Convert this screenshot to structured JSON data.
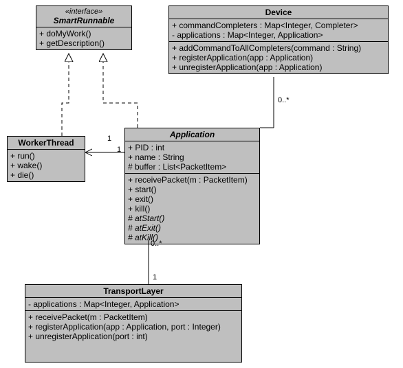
{
  "chart_data": {
    "type": "table",
    "diagram": "UML class diagram",
    "classes": [
      {
        "name": "SmartRunnable",
        "stereotype": "«interface»",
        "kind": "interface",
        "methods": [
          "+ doMyWork()",
          "+ getDescription()"
        ]
      },
      {
        "name": "Device",
        "kind": "class",
        "attributes": [
          "+ commandCompleters : Map<Integer, Completer>",
          "- applications : Map<Integer, Application>"
        ],
        "methods": [
          "+ addCommandToAllCompleters(command : String)",
          "+ registerApplication(app : Application)",
          "+ unregisterApplication(app : Application)"
        ]
      },
      {
        "name": "WorkerThread",
        "kind": "class",
        "methods": [
          "+ run()",
          "+ wake()",
          "+ die()"
        ]
      },
      {
        "name": "Application",
        "kind": "class",
        "attributes": [
          "+ PID : int",
          "+ name : String",
          "# buffer : List<PacketItem>"
        ],
        "methods": [
          "+ receivePacket(m : PacketItem)",
          "+ start()",
          "+ exit()",
          "+ kill()",
          "# atStart()",
          "# atExit()",
          "# atKill()"
        ],
        "abstract_methods": [
          "atStart()",
          "atExit()",
          "atKill()"
        ]
      },
      {
        "name": "TransportLayer",
        "kind": "class",
        "attributes": [
          "- applications : Map<Integer, Application>"
        ],
        "methods": [
          "+ receivePacket(m : PacketItem)",
          "+ registerApplication(app : Application, port : Integer)",
          "+ unregisterApplication(port : int)"
        ]
      }
    ],
    "relationships": [
      {
        "type": "realization",
        "from": "WorkerThread",
        "to": "SmartRunnable"
      },
      {
        "type": "realization",
        "from": "Application",
        "to": "SmartRunnable"
      },
      {
        "type": "association",
        "from": "Application",
        "to": "WorkerThread",
        "from_mult": "1",
        "to_mult": "1",
        "nav": "to"
      },
      {
        "type": "association",
        "from": "Device",
        "to": "Application",
        "to_mult": "0..*"
      },
      {
        "type": "association",
        "from": "TransportLayer",
        "to": "Application",
        "from_mult": "1",
        "to_mult": "0..*"
      }
    ]
  },
  "smartRunnable": {
    "stereo": "«interface»",
    "name": "SmartRunnable",
    "m1": "+ doMyWork()",
    "m2": "+ getDescription()"
  },
  "device": {
    "name": "Device",
    "a1": "+ commandCompleters : Map<Integer, Completer>",
    "a2": "- applications : Map<Integer, Application>",
    "m1": "+ addCommandToAllCompleters(command : String)",
    "m2": "+ registerApplication(app : Application)",
    "m3": "+ unregisterApplication(app : Application)"
  },
  "worker": {
    "name": "WorkerThread",
    "m1": "+ run()",
    "m2": "+ wake()",
    "m3": "+ die()"
  },
  "app": {
    "name": "Application",
    "a1": "+ PID : int",
    "a2": "+ name : String",
    "a3": "# buffer : List<PacketItem>",
    "m1": "+ receivePacket(m : PacketItem)",
    "m2": "+ start()",
    "m3": "+ exit()",
    "m4": "+ kill()",
    "m5": "# atStart()",
    "m6": "# atExit()",
    "m7": "# atKill()"
  },
  "transport": {
    "name": "TransportLayer",
    "a1": "- applications : Map<Integer, Application>",
    "m1": "+ receivePacket(m : PacketItem)",
    "m2": "+ registerApplication(app : Application, port : Integer)",
    "m3": "+ unregisterApplication(port : int)"
  },
  "mult": {
    "app_wt_app": "1",
    "app_wt_wt": "1",
    "dev_app": "0..*",
    "tl_app_tl": "1",
    "tl_app_app": "0..*"
  }
}
